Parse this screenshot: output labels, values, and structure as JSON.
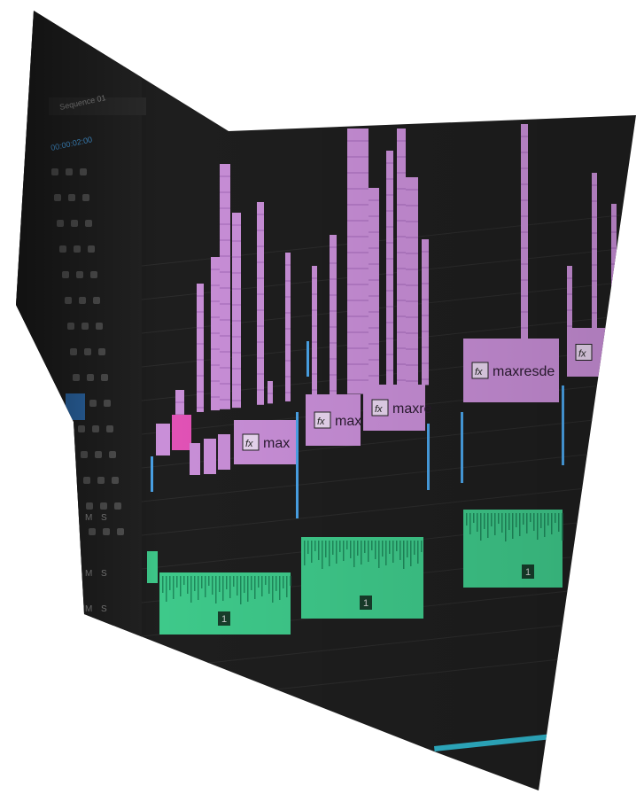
{
  "app": {
    "sequence_label": "Sequence 01",
    "timecode": "00:00:02:00"
  },
  "colors": {
    "background": "#1e1e1e",
    "panel": "#242424",
    "video_clip": "#c98fd8",
    "video_clip_dark": "#a368b8",
    "video_clip_selected": "#e252b6",
    "audio_clip": "#3ec98a",
    "audio_clip_dark": "#1f8a5c",
    "blue_marker": "#4aa3e8",
    "timeline_bar": "#2fb3c9"
  },
  "track_header_icons": [
    "eye-icon",
    "lock-icon",
    "toggle-icon"
  ],
  "audio_track_controls": {
    "mute": "M",
    "solo": "S"
  },
  "video_clips": [
    {
      "label": "max",
      "fx": "fx"
    },
    {
      "label": "maxi",
      "fx": "fx"
    },
    {
      "label": "maxre",
      "fx": "fx"
    },
    {
      "label": "maxresde",
      "fx": "fx"
    },
    {
      "label": "",
      "fx": "fx"
    }
  ],
  "audio_clip_badges": [
    "1",
    "1",
    "1"
  ]
}
